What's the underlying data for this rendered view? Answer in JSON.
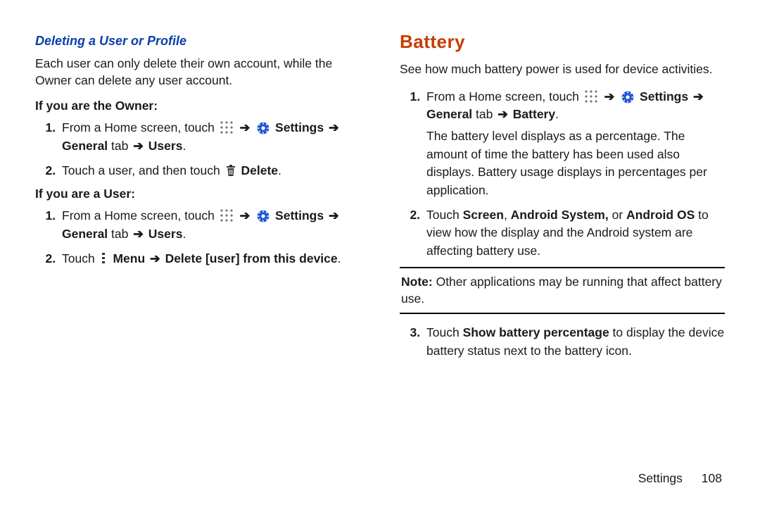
{
  "left": {
    "heading": "Deleting a User or Profile",
    "intro": "Each user can only delete their own account, while the Owner can delete any user account.",
    "owner_label": "If you are the Owner:",
    "owner_steps": {
      "s1_pre": "From a Home screen, touch ",
      "s1_settings": "Settings",
      "s1_general": "General",
      "s1_tab": " tab ",
      "s1_users": "Users",
      "s2_a": "Touch a user, and then touch ",
      "s2_delete": "Delete"
    },
    "user_label": "If you are a User:",
    "user_steps": {
      "s1_pre": "From a Home screen, touch ",
      "s1_settings": "Settings",
      "s1_general": "General",
      "s1_tab": " tab ",
      "s1_users": "Users",
      "s2_a": "Touch ",
      "s2_menu": "Menu",
      "s2_delete": "Delete [user] from this device"
    }
  },
  "right": {
    "heading": "Battery",
    "intro": "See how much battery power is used for device activities.",
    "step1": {
      "pre": "From a Home screen, touch ",
      "settings": "Settings",
      "general": "General",
      "tab": " tab ",
      "battery": "Battery",
      "desc": "The battery level displays as a percentage. The amount of time the battery has been used also displays. Battery usage displays in percentages per application."
    },
    "step2_a": "Touch ",
    "step2_b1": "Screen",
    "step2_c": ", ",
    "step2_b2": "Android System,",
    "step2_or": " or ",
    "step2_b3": "Android OS",
    "step2_tail": " to view how the display and the Android system are affecting battery use.",
    "note_label": "Note:",
    "note_body": " Other applications may be running that affect battery use.",
    "step3_a": "Touch ",
    "step3_b": "Show battery percentage",
    "step3_tail": " to display the device battery status next to the battery icon."
  },
  "footer": {
    "section": "Settings",
    "page": "108"
  },
  "glyphs": {
    "arrow": "➔"
  }
}
